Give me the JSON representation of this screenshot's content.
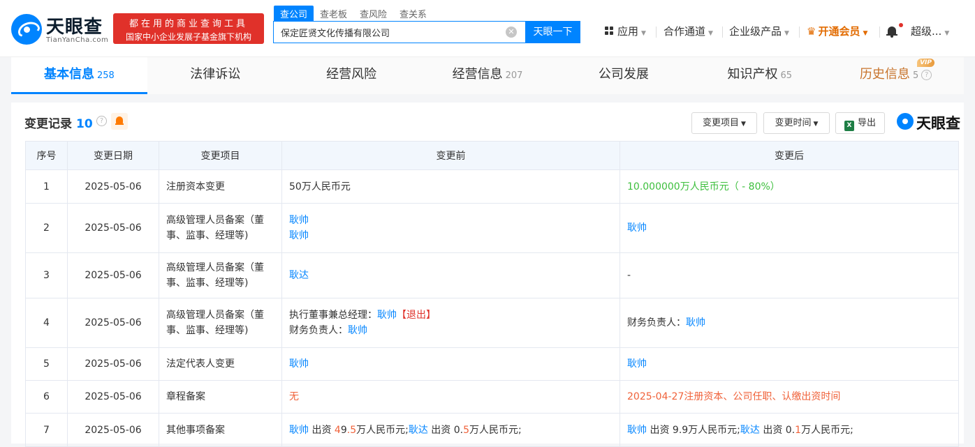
{
  "header": {
    "logo_text": "天眼查",
    "logo_sub": "TianYanCha.com",
    "promo_line1": "都在用的商业查询工具",
    "promo_line2": "国家中小企业发展子基金旗下机构",
    "search_tabs": [
      "查公司",
      "查老板",
      "查风险",
      "查关系"
    ],
    "search_value": "保定匠贤文化传播有限公司",
    "search_button": "天眼一下",
    "nav": {
      "apps": "应用",
      "channel": "合作通道",
      "enterprise": "企业级产品",
      "vip": "开通会员",
      "user": "超级..."
    }
  },
  "main_tabs": [
    {
      "label": "基本信息",
      "count": "258"
    },
    {
      "label": "法律诉讼",
      "count": ""
    },
    {
      "label": "经营风险",
      "count": ""
    },
    {
      "label": "经营信息",
      "count": "207"
    },
    {
      "label": "公司发展",
      "count": ""
    },
    {
      "label": "知识产权",
      "count": "65"
    },
    {
      "label": "历史信息",
      "count": "5",
      "badge": "VIP"
    }
  ],
  "section": {
    "title": "变更记录",
    "count": "10",
    "btn_item": "变更项目",
    "btn_time": "变更时间",
    "btn_export": "导出",
    "watermark": "天眼查"
  },
  "table": {
    "headers": [
      "序号",
      "变更日期",
      "变更项目",
      "变更前",
      "变更后"
    ],
    "rows": [
      {
        "no": "1",
        "date": "2025-05-06",
        "item": "注册资本变更",
        "before": "50万人民币元",
        "after": "10.000000万人民币元（ - 80%）"
      },
      {
        "no": "2",
        "date": "2025-05-06",
        "item": "高级管理人员备案（董事、监事、经理等)",
        "before_l1": "耿帅",
        "before_l2": "耿帅",
        "after": "耿帅"
      },
      {
        "no": "3",
        "date": "2025-05-06",
        "item": "高级管理人员备案（董事、监事、经理等)",
        "before": "耿达",
        "after": "-"
      },
      {
        "no": "4",
        "date": "2025-05-06",
        "item": "高级管理人员备案（董事、监事、经理等)",
        "before_l1_label": "执行董事兼总经理：",
        "before_l1_name": "耿帅",
        "before_l1_tag": "【退出】",
        "before_l2_label": "财务负责人：",
        "before_l2_name": "耿帅",
        "after_label": "财务负责人：",
        "after_name": "耿帅"
      },
      {
        "no": "5",
        "date": "2025-05-06",
        "item": "法定代表人变更",
        "before": "耿帅",
        "after": "耿帅"
      },
      {
        "no": "6",
        "date": "2025-05-06",
        "item": "章程备案",
        "before": "无",
        "after": "2025-04-27注册资本、公司任职、认缴出资时间"
      },
      {
        "no": "7",
        "date": "2025-05-06",
        "item": "其他事项备案",
        "before": {
          "p1_name": "耿帅",
          "p1_pre": " 出资 ",
          "p1_d1": "4",
          "p1_mid": "9",
          "p1_d2": ".5",
          "p1_unit": "万人民币元;",
          "p2_name": "耿达",
          "p2_pre": " 出资 ",
          "p2_d1": "0",
          "p2_mid": ".",
          "p2_d2": "5",
          "p2_unit": "万人民币元;"
        },
        "after": {
          "p1_name": "耿帅",
          "p1_pre": " 出资 ",
          "p1_d1": "9.9",
          "p1_unit": "万人民币元;",
          "p2_name": "耿达",
          "p2_pre": " 出资 ",
          "p2_d1": "0.",
          "p2_d2": "1",
          "p2_unit": "万人民币元;"
        }
      }
    ]
  }
}
